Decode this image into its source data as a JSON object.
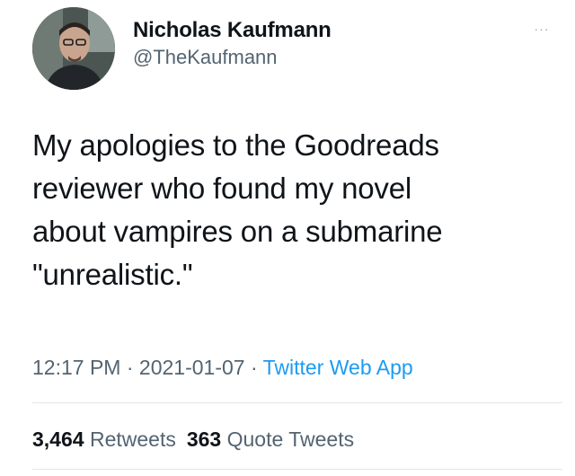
{
  "author": {
    "display_name": "Nicholas Kaufmann",
    "handle": "@TheKaufmann"
  },
  "tweet": {
    "text_lines": [
      "My apologies to the Goodreads",
      "reviewer who found my novel",
      "about vampires on a submarine",
      "\"unrealistic.\""
    ],
    "time": "12:17 PM",
    "separator": "·",
    "date": "2021-01-07",
    "source": "Twitter Web App"
  },
  "stats": {
    "retweets_count": "3,464",
    "retweets_label": "Retweets",
    "quote_tweets_count": "363",
    "quote_tweets_label": "Quote Tweets"
  },
  "menu": {
    "more_label": "···"
  },
  "colors": {
    "text_primary": "#0f1419",
    "text_secondary": "#536471",
    "link": "#1d9bf0",
    "divider": "#e1e6ea"
  },
  "icons": {
    "more": "more-options-icon",
    "avatar": "avatar"
  }
}
